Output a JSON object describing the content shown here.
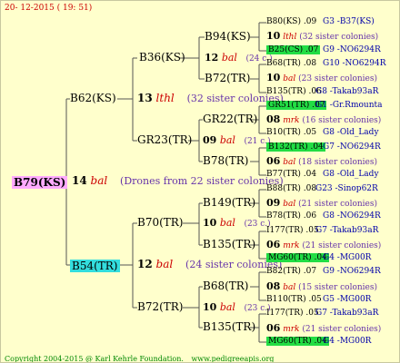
{
  "header": {
    "date": "20- 12-2015 ( 19: 51)"
  },
  "footer": {
    "copyright": "Copyright 2004-2015 @ Karl Kehrle Foundation.",
    "url": "www.pedigreeapis.org"
  },
  "root": {
    "id": "B79(KS)",
    "num": "14",
    "year": "bal",
    "note": "(Drones from 22 sister colonies)"
  },
  "sire": {
    "id": "B62(KS)",
    "num": "13",
    "year": "lthl",
    "note": "(32 sister colonies)"
  },
  "dam": {
    "id": "B54(TR)",
    "num": "12",
    "year": "bal",
    "note": "(24 sister colonies)"
  },
  "gen3": [
    {
      "id": "B36(KS)"
    },
    {
      "id": "GR23(TR)",
      "num": "09",
      "year": "bal",
      "note": "(21 c.)"
    },
    {
      "id": "B70(TR)",
      "num": "10",
      "year": "bal",
      "note": "(23 c.)"
    },
    {
      "id": "B72(TR)",
      "num": "10",
      "year": "bal",
      "note": "(23 c.)"
    }
  ],
  "gen3_sire_num": {
    "num": "12",
    "year": "bal",
    "note": "(24 c.)"
  },
  "gen4": [
    {
      "id": "B94(KS)"
    },
    {
      "id": "B72(TR)"
    },
    {
      "id": "GR22(TR)"
    },
    {
      "id": "B78(TR)"
    },
    {
      "id": "B149(TR)"
    },
    {
      "id": "B135(TR)"
    },
    {
      "id": "B68(TR)"
    },
    {
      "id": "B135(TR)"
    }
  ],
  "gen4_nums": [
    {
      "num": "12",
      "year": "bal",
      "note": "(24 c.)"
    },
    {
      "num": "10",
      "year": "bal",
      "note": "(23 c.)"
    },
    {
      "num": "09",
      "year": "bal",
      "note": "(21 c.)"
    },
    {
      "num": "10",
      "year": "bal",
      "note": "(23 c.)"
    }
  ],
  "gen5": [
    {
      "id": "B80(KS)",
      "yr": ".09",
      "gg": "G3 -B37(KS)",
      "hl": ""
    },
    {
      "id": "10",
      "year": "lthl",
      "note": "(32 sister colonies)",
      "type": "drone"
    },
    {
      "id": "B25(CS)",
      "yr": ".07",
      "gg": "G9 -NO6294R",
      "hl": "green"
    },
    {
      "id": "B68(TR)",
      "yr": ".08",
      "gg": "G10 -NO6294R",
      "hl": ""
    },
    {
      "id": "10",
      "year": "bal",
      "note": "(23 sister colonies)",
      "type": "drone"
    },
    {
      "id": "B135(TR)",
      "yr": ".06",
      "gg": "G8 -Takab93aR",
      "hl": ""
    },
    {
      "id": "GR51(TR)",
      "yr": ".07",
      "gg": "G1 -Gr.Rmounta",
      "hl": "green"
    },
    {
      "id": "08",
      "year": "mrk",
      "note": "(16 sister colonies)",
      "type": "drone"
    },
    {
      "id": "B10(TR)",
      "yr": ".05",
      "gg": "G8 -Old_Lady",
      "hl": ""
    },
    {
      "id": "B132(TR)",
      "yr": ".04",
      "gg": "G7 -NO6294R",
      "hl": "green"
    },
    {
      "id": "06",
      "year": "bal",
      "note": "(18 sister colonies)",
      "type": "drone"
    },
    {
      "id": "B77(TR)",
      "yr": ".04",
      "gg": "G8 -Old_Lady",
      "hl": ""
    },
    {
      "id": "B88(TR)",
      "yr": ".08",
      "gg": "G23 -Sinop62R",
      "hl": ""
    },
    {
      "id": "09",
      "year": "bal",
      "note": "(21 sister colonies)",
      "type": "drone"
    },
    {
      "id": "B78(TR)",
      "yr": ".06",
      "gg": "G8 -NO6294R",
      "hl": ""
    },
    {
      "id": "I177(TR)",
      "yr": ".05",
      "gg": "G7 -Takab93aR",
      "hl": ""
    },
    {
      "id": "06",
      "year": "mrk",
      "note": "(21 sister colonies)",
      "type": "drone"
    },
    {
      "id": "MG60(TR)",
      "yr": ".04",
      "gg": "G4 -MG00R",
      "hl": "green"
    },
    {
      "id": "B82(TR)",
      "yr": ".07",
      "gg": "G9 -NO6294R",
      "hl": ""
    },
    {
      "id": "08",
      "year": "bal",
      "note": "(15 sister colonies)",
      "type": "drone"
    },
    {
      "id": "B110(TR)",
      "yr": ".05",
      "gg": "G5 -MG00R",
      "hl": ""
    },
    {
      "id": "I177(TR)",
      "yr": ".05",
      "gg": "G7 -Takab93aR",
      "hl": ""
    },
    {
      "id": "06",
      "year": "mrk",
      "note": "(21 sister colonies)",
      "type": "drone"
    },
    {
      "id": "MG60(TR)",
      "yr": ".04",
      "gg": "G4 -MG00R",
      "hl": "green"
    }
  ]
}
